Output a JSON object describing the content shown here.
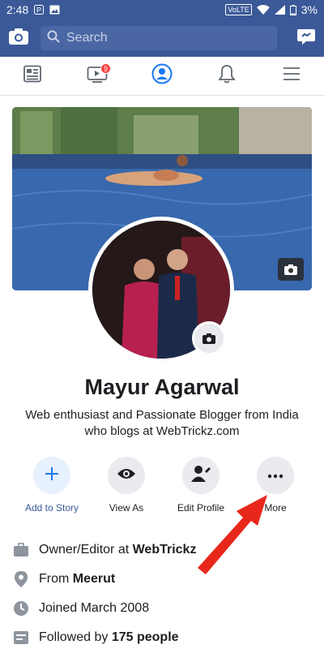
{
  "status_bar": {
    "time": "2:48",
    "network": "VoLTE",
    "battery": "3%"
  },
  "header": {
    "search_placeholder": "Search"
  },
  "nav": {
    "badge_count": "9"
  },
  "profile": {
    "name": "Mayur Agarwal",
    "bio": "Web enthusiast and Passionate Blogger from India who blogs at WebTrickz.com"
  },
  "actions": [
    {
      "label": "Add to Story"
    },
    {
      "label": "View As"
    },
    {
      "label": "Edit Profile"
    },
    {
      "label": "More"
    }
  ],
  "info": {
    "work_prefix": "Owner/Editor at ",
    "work_company": "WebTrickz",
    "from_prefix": "From ",
    "from_place": "Meerut",
    "joined": "Joined March 2008",
    "followed_prefix": "Followed by ",
    "followed_count": "175 people"
  },
  "colors": {
    "brand": "#3b5998",
    "badge": "#fa3e3e",
    "arrow": "#e8271b"
  }
}
